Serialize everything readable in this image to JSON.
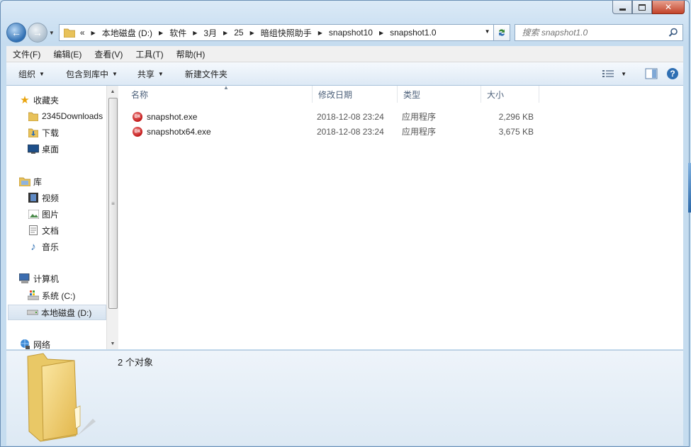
{
  "window": {
    "title_buttons": {
      "minimize": "minimize",
      "maximize": "maximize",
      "close": "close"
    }
  },
  "navigation": {
    "back_icon": "back-arrow-icon",
    "forward_icon": "forward-arrow-icon",
    "crumb_overflow": "«",
    "breadcrumbs": [
      "本地磁盘 (D:)",
      "软件",
      "3月",
      "25",
      "暗组快照助手",
      "snapshot10",
      "snapshot1.0"
    ],
    "search_placeholder": "搜索 snapshot1.0"
  },
  "menubar": {
    "items": [
      "文件(F)",
      "编辑(E)",
      "查看(V)",
      "工具(T)",
      "帮助(H)"
    ]
  },
  "toolbar": {
    "organize": "组织",
    "include_in_library": "包含到库中",
    "share": "共享",
    "new_folder": "新建文件夹"
  },
  "sidebar": {
    "favorites": {
      "label": "收藏夹",
      "items": [
        "2345Downloads",
        "下载",
        "桌面"
      ]
    },
    "libraries": {
      "label": "库",
      "items": [
        "视频",
        "图片",
        "文档",
        "音乐"
      ]
    },
    "computer": {
      "label": "计算机",
      "items": [
        "系统 (C:)",
        "本地磁盘 (D:)"
      ]
    },
    "network": {
      "label": "网络"
    }
  },
  "file_list": {
    "columns": [
      "名称",
      "修改日期",
      "类型",
      "大小"
    ],
    "files": [
      {
        "name": "snapshot.exe",
        "modified": "2018-12-08 23:24",
        "type": "应用程序",
        "size": "2,296 KB",
        "icon_text": "DX"
      },
      {
        "name": "snapshotx64.exe",
        "modified": "2018-12-08 23:24",
        "type": "应用程序",
        "size": "3,675 KB",
        "icon_text": "DX"
      }
    ]
  },
  "details": {
    "count": "2 个对象"
  },
  "colors": {
    "accent": "#2f6fb3",
    "app_icon": "#c21818",
    "close_button": "#c2432a"
  }
}
